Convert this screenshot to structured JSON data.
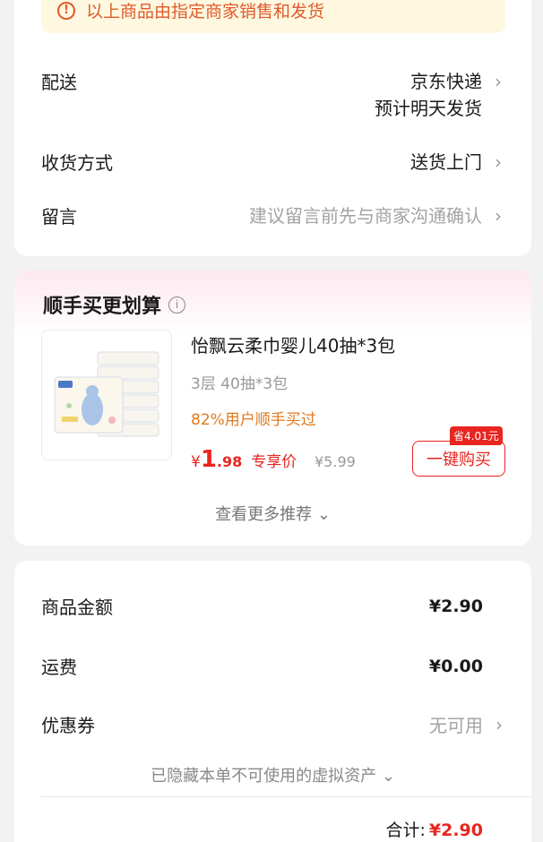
{
  "notice": {
    "icon": "info-icon",
    "text": "以上商品由指定商家销售和发货"
  },
  "shipping": {
    "delivery_label": "配送",
    "delivery_carrier": "京东快递",
    "delivery_eta": "预计明天发货",
    "receive_label": "收货方式",
    "receive_value": "送货上门",
    "message_label": "留言",
    "message_placeholder": "建议留言前先与商家沟通确认",
    "chevron": "›"
  },
  "recommend": {
    "title": "顺手买更划算",
    "info_icon": "i",
    "product": {
      "name": "怡飘云柔巾婴儿40抽*3包",
      "spec": "3层 40抽*3包",
      "tag": "82%用户顺手买过",
      "price_currency": "¥",
      "price_int": "1",
      "price_dec": ".98",
      "exclusive_label": "专享价",
      "original_price": "¥5.99",
      "save_badge": "省4.01元",
      "buy_label": "一键购买"
    },
    "more_label": "查看更多推荐",
    "more_chevron": "⌄"
  },
  "summary": {
    "goods_label": "商品金额",
    "goods_value": "¥2.90",
    "freight_label": "运费",
    "freight_value": "¥0.00",
    "coupon_label": "优惠券",
    "coupon_value": "无可用",
    "hidden_assets": "已隐藏本单不可使用的虚拟资产",
    "hidden_chevron": "⌄",
    "total_label": "合计:",
    "total_value": "¥2.90"
  },
  "colors": {
    "accent_red": "#e8251f",
    "notice_bg": "#fff8e1",
    "tag_orange": "#e07a1f"
  }
}
